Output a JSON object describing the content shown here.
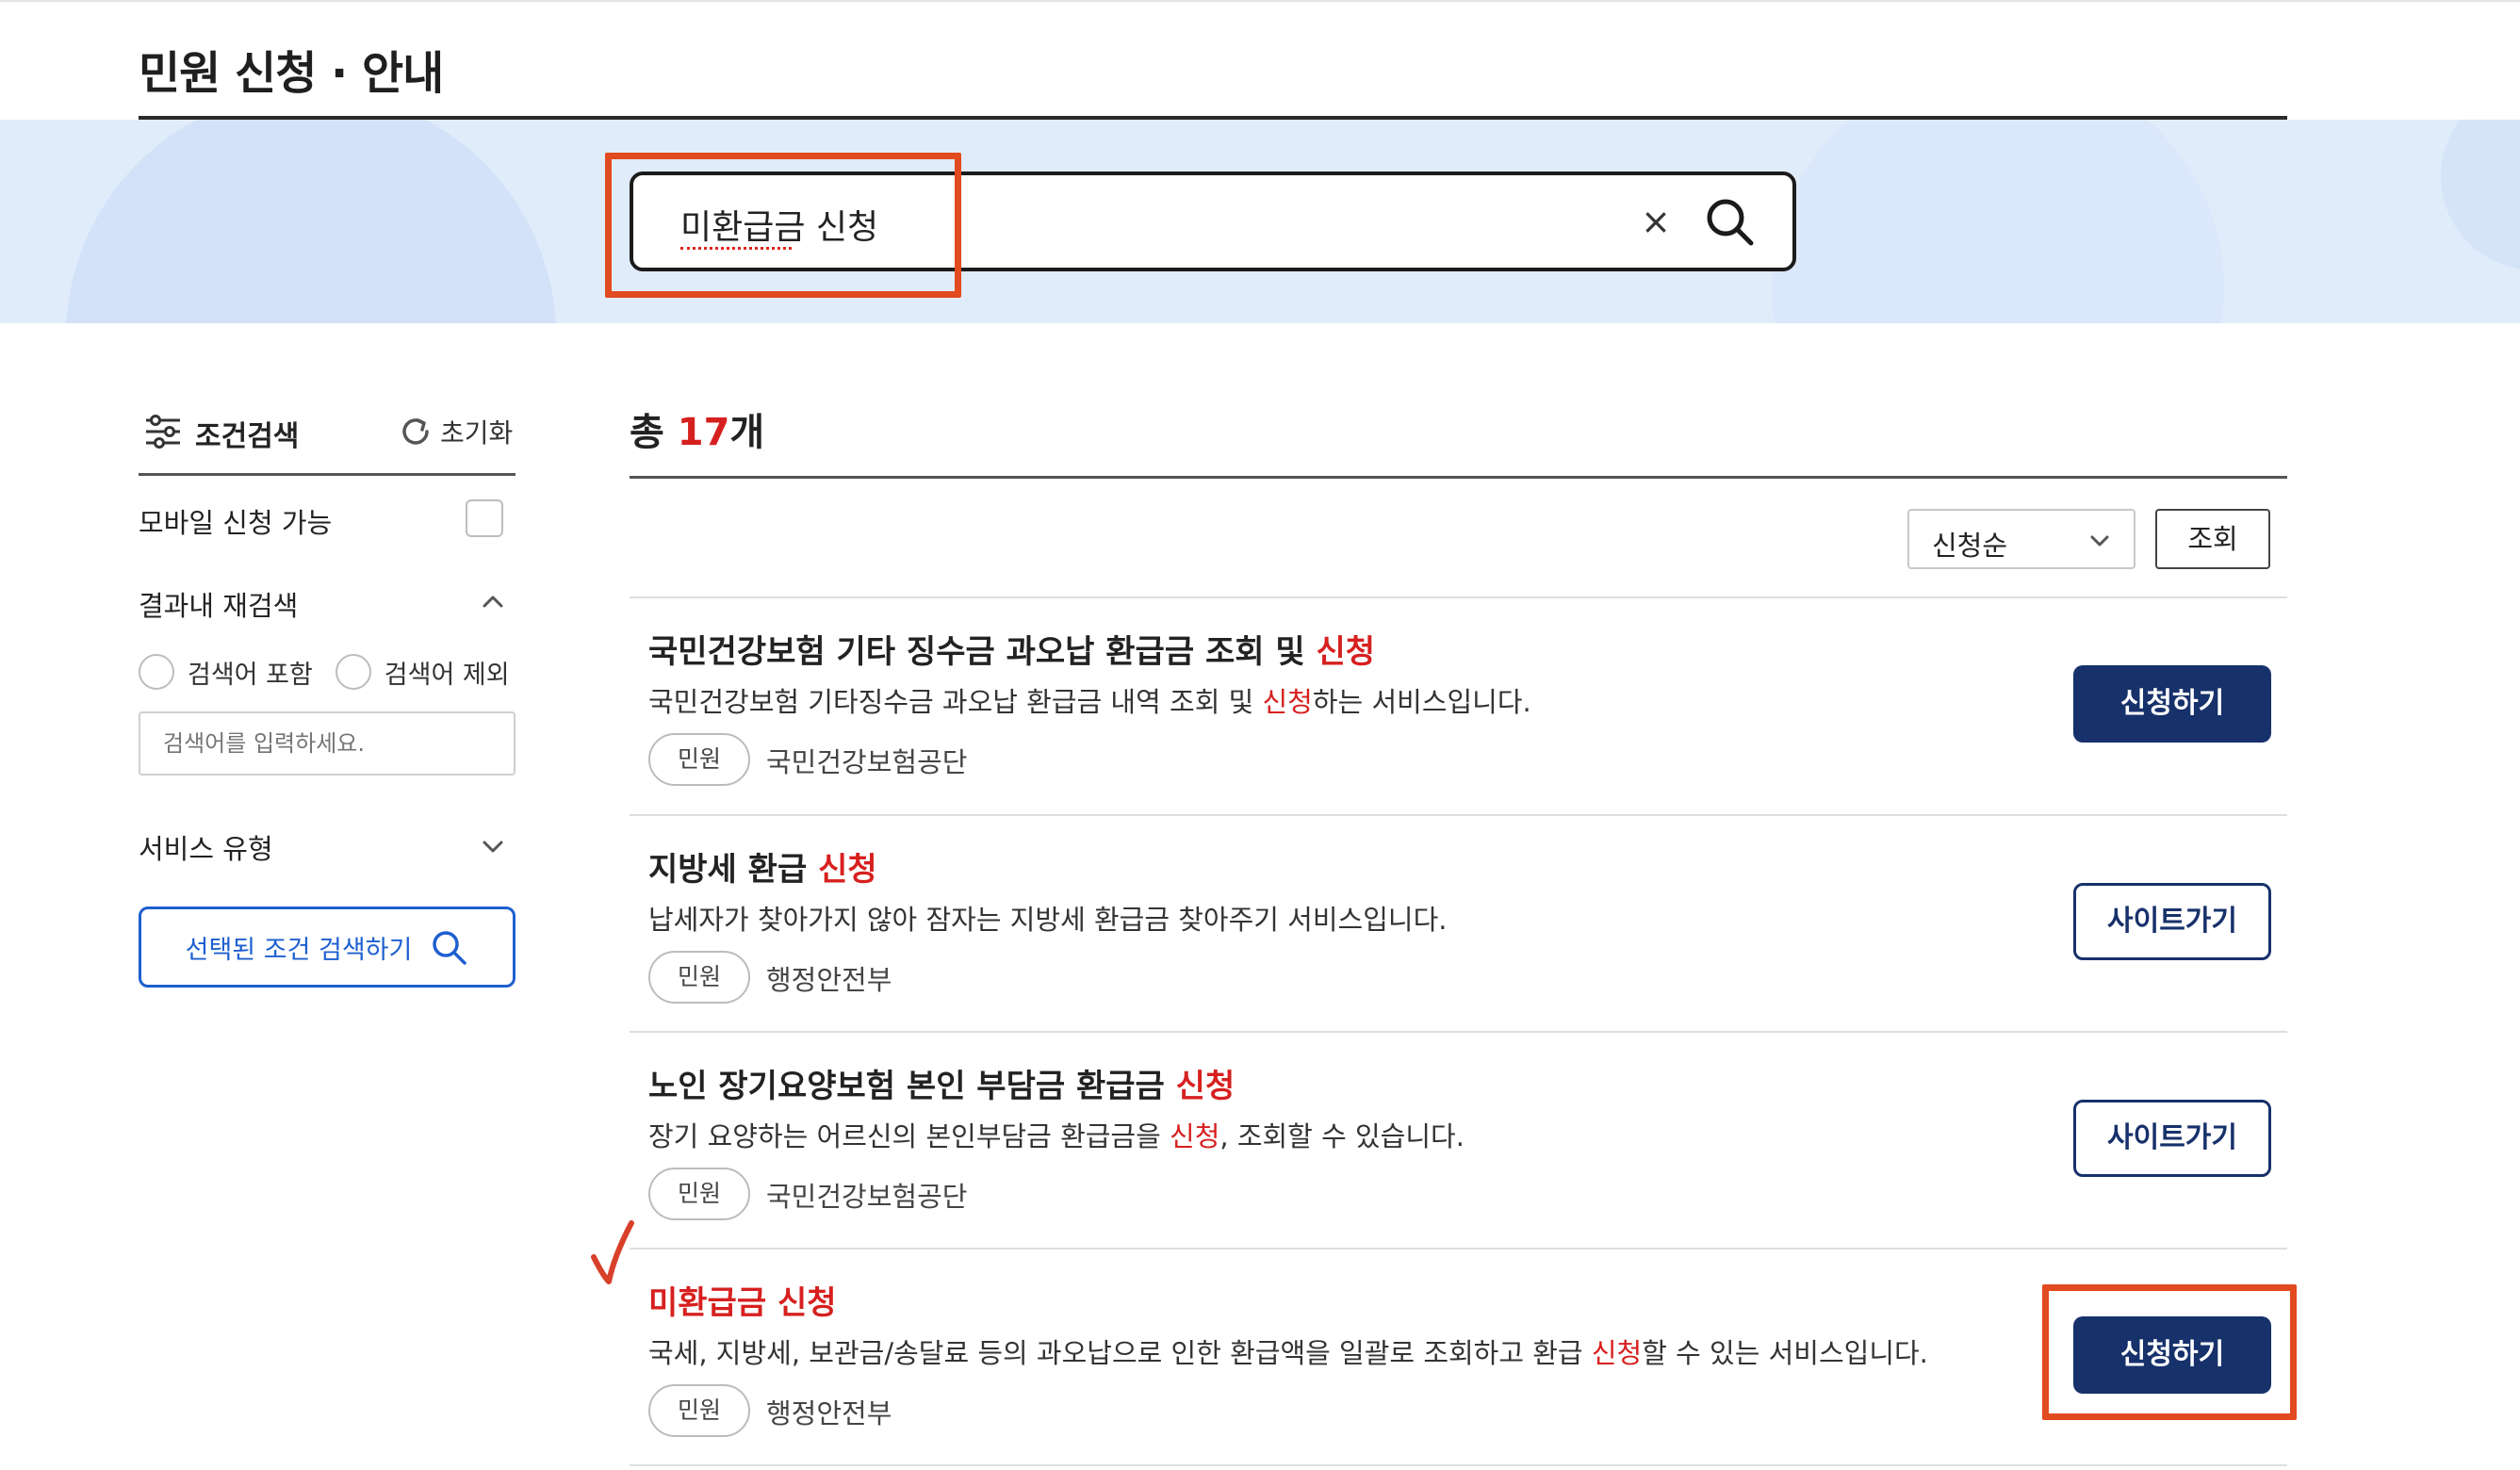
{
  "page": {
    "title": "민원 신청 · 안내"
  },
  "search": {
    "query": "미환급금 신청",
    "clear_icon": "close-icon",
    "search_icon": "search-icon"
  },
  "filter": {
    "header_label": "조건검색",
    "reset_label": "초기화",
    "mobile_label": "모바일 신청 가능",
    "refine_label": "결과내 재검색",
    "radio_include": "검색어 포함",
    "radio_exclude": "검색어 제외",
    "refine_placeholder": "검색어를 입력하세요.",
    "service_type_label": "서비스 유형",
    "search_button_label": "선택된 조건 검색하기"
  },
  "results": {
    "total_prefix": "총 ",
    "total_count": "17",
    "total_suffix": "개",
    "sort_selected": "신청순",
    "view_button": "조회",
    "items": [
      {
        "title_before": "국민건강보험 기타 징수금 과오납 환급금 조회 및 ",
        "title_highlight": "신청",
        "desc_before": "국민건강보험 기타징수금 과오납 환급금 내역 조회 및 ",
        "desc_highlight": "신청",
        "desc_after": "하는 서비스입니다.",
        "tag": "민원",
        "org": "국민건강보험공단",
        "button": "신청하기"
      },
      {
        "title_before": "지방세 환급 ",
        "title_highlight": "신청",
        "desc_before": "납세자가 찾아가지 않아 잠자는 지방세 환급금 찾아주기 서비스입니다.",
        "desc_highlight": "",
        "desc_after": "",
        "tag": "민원",
        "org": "행정안전부",
        "button": "사이트가기"
      },
      {
        "title_before": "노인 장기요양보험 본인 부담금 환급금 ",
        "title_highlight": "신청",
        "desc_before": "장기 요양하는 어르신의 본인부담금 환급금을 ",
        "desc_highlight": "신청",
        "desc_after": ", 조회할 수 있습니다.",
        "tag": "민원",
        "org": "국민건강보험공단",
        "button": "사이트가기"
      },
      {
        "title_before": "미환급금 ",
        "title_highlight": "신청",
        "desc_before": "국세, 지방세, 보관금/송달료 등의 과오납으로 인한 환급액을 일괄로 조회하고 환급 ",
        "desc_highlight": "신청",
        "desc_after": "할 수 있는 서비스입니다.",
        "tag": "민원",
        "org": "행정안전부",
        "button": "신청하기"
      }
    ]
  },
  "colors": {
    "accent_red": "#d6201f",
    "navy_button": "#17316b",
    "blue_outline": "#1e5fd0",
    "annotation_orange": "#e24a1f",
    "search_band": "#e1ecfb"
  }
}
